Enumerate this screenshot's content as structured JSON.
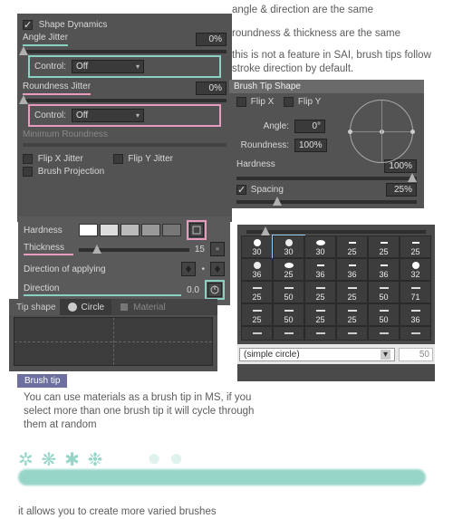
{
  "notes": {
    "a": "angle & direction are the same",
    "b": "roundness & thickness are the same",
    "c": "this is not a feature in SAI, brush tips follow stroke direction by default.",
    "d": "You can use materials as a brush tip in MS, if you select more than one brush tip it will cycle through them at random",
    "e": "it allows you to create more varied brushes"
  },
  "panelA": {
    "title": "Shape Dynamics",
    "angle_jitter_label": "Angle Jitter",
    "angle_jitter_value": "0%",
    "control_label": "Control:",
    "control_value": "Off",
    "roundness_jitter_label": "Roundness Jitter",
    "roundness_jitter_value": "0%",
    "min_roundness_label": "Minimum Roundness",
    "flipx_label": "Flip X Jitter",
    "flipy_label": "Flip Y Jitter",
    "projection_label": "Brush Projection"
  },
  "panelB": {
    "title": "Brush Tip Shape",
    "flipx": "Flip X",
    "flipy": "Flip Y",
    "angle_label": "Angle:",
    "angle_value": "0°",
    "roundness_label": "Roundness:",
    "roundness_value": "100%",
    "hardness_label": "Hardness",
    "hardness_value": "100%",
    "spacing_label": "Spacing",
    "spacing_value": "25%"
  },
  "panelC": {
    "hardness_label": "Hardness",
    "thickness_label": "Thickness",
    "thickness_value": "15",
    "dir_apply_label": "Direction of applying",
    "direction_label": "Direction",
    "direction_value": "0.0"
  },
  "panelD": {
    "section": "Tip shape",
    "circle_tab": "Circle",
    "material_tab": "Material"
  },
  "panelE": {
    "rows": [
      [
        "30",
        "30",
        "30",
        "25",
        "25",
        "25"
      ],
      [
        "36",
        "25",
        "36",
        "36",
        "36",
        "32"
      ],
      [
        "25",
        "50",
        "25",
        "25",
        "50",
        "71"
      ],
      [
        "25",
        "50",
        "25",
        "25",
        "50",
        "36"
      ]
    ],
    "selected": "(simple circle)",
    "size": "50"
  },
  "brushtip_tab": "Brush tip"
}
